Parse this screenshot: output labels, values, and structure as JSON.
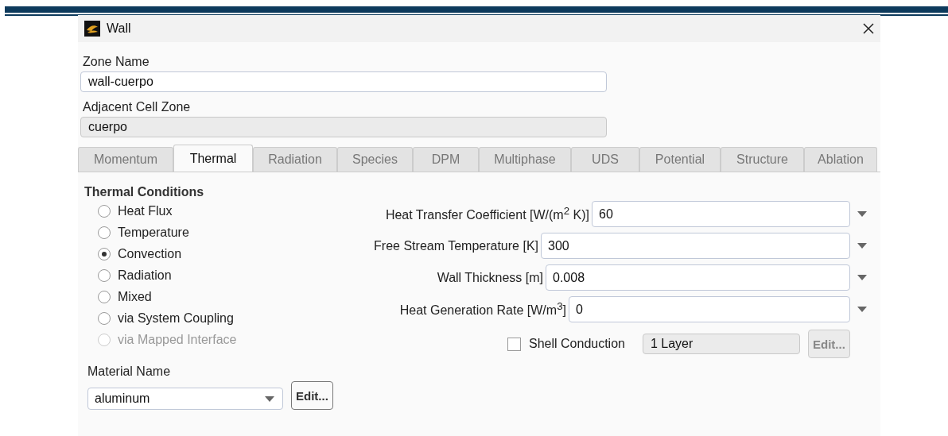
{
  "window": {
    "title": "Wall"
  },
  "zone_name": {
    "label": "Zone Name",
    "value": "wall-cuerpo"
  },
  "adjacent_cell_zone": {
    "label": "Adjacent Cell Zone",
    "value": "cuerpo",
    "disabled": true
  },
  "tabs": [
    {
      "label": "Momentum",
      "selected": false
    },
    {
      "label": "Thermal",
      "selected": true
    },
    {
      "label": "Radiation",
      "selected": false
    },
    {
      "label": "Species",
      "selected": false
    },
    {
      "label": "DPM",
      "selected": false
    },
    {
      "label": "Multiphase",
      "selected": false
    },
    {
      "label": "UDS",
      "selected": false
    },
    {
      "label": "Potential",
      "selected": false
    },
    {
      "label": "Structure",
      "selected": false
    },
    {
      "label": "Ablation",
      "selected": false
    }
  ],
  "thermal_conditions": {
    "title": "Thermal Conditions",
    "options": [
      {
        "label": "Heat Flux",
        "selected": false,
        "disabled": false
      },
      {
        "label": "Temperature",
        "selected": false,
        "disabled": false
      },
      {
        "label": "Convection",
        "selected": true,
        "disabled": false
      },
      {
        "label": "Radiation",
        "selected": false,
        "disabled": false
      },
      {
        "label": "Mixed",
        "selected": false,
        "disabled": false
      },
      {
        "label": "via System Coupling",
        "selected": false,
        "disabled": false
      },
      {
        "label": "via Mapped Interface",
        "selected": false,
        "disabled": true
      }
    ]
  },
  "parameters": [
    {
      "label": "Heat Transfer Coefficient [W/(m$^{2}$ K)]",
      "value": "60"
    },
    {
      "label": "Free Stream Temperature [K]",
      "value": "300"
    },
    {
      "label": "Wall Thickness [m]",
      "value": "0.008"
    },
    {
      "label": "Heat Generation Rate [W/m$^{3}$]",
      "value": "0"
    }
  ],
  "shell_conduction": {
    "label": "Shell Conduction",
    "checked": false,
    "layers": "1 Layer",
    "edit_button": "Edit...",
    "disabled": true
  },
  "material": {
    "label": "Material Name",
    "value": "aluminum",
    "edit_button": "Edit..."
  }
}
